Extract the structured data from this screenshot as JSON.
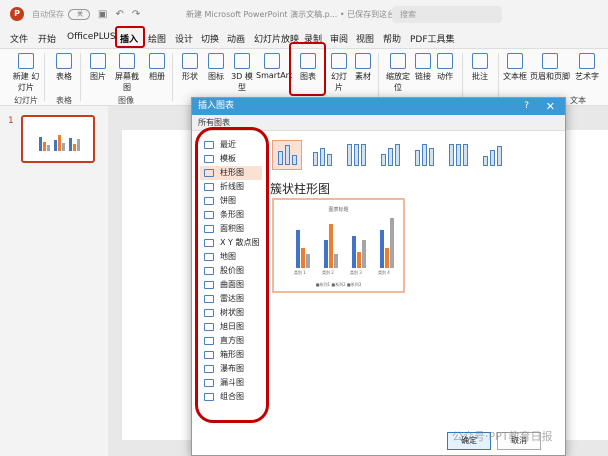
{
  "titlebar": {
    "autosave_label": "自动保存",
    "toggle_state": "关",
    "doc_title": "新建 Microsoft PowerPoint 演示文稿.p... • 已保存到这台电脑",
    "search_placeholder": "搜索"
  },
  "menu": {
    "tabs": [
      "文件",
      "开始",
      "OfficePLUS",
      "插入",
      "绘图",
      "设计",
      "切换",
      "动画",
      "幻灯片放映",
      "录制",
      "审阅",
      "视图",
      "帮助",
      "PDF工具集"
    ],
    "active_tab": "插入"
  },
  "ribbon": {
    "items": [
      "新建\n幻灯片",
      "表格",
      "图片",
      "屏幕截图",
      "相册",
      "形状",
      "图标",
      "3D 模型",
      "SmartArt",
      "图表",
      "幻灯片",
      "素材",
      "缩放定位",
      "链接",
      "动作",
      "批注",
      "文本框",
      "页眉和页脚",
      "艺术字"
    ],
    "groups": [
      "幻灯片",
      "表格",
      "图像",
      "文本"
    ]
  },
  "slide_panel": {
    "slide_number": "1"
  },
  "dialog": {
    "title": "插入图表",
    "help": "?",
    "close": "✕",
    "tab_label": "所有图表",
    "categories": [
      "最近",
      "模板",
      "柱形图",
      "折线图",
      "饼图",
      "条形图",
      "面积图",
      "X Y 散点图",
      "地图",
      "股价图",
      "曲面图",
      "雷达图",
      "树状图",
      "旭日图",
      "直方图",
      "箱形图",
      "瀑布图",
      "漏斗图",
      "组合图"
    ],
    "active_category": "柱形图",
    "subtype_title": "簇状柱形图",
    "preview": {
      "title": "图表标题",
      "categories": [
        "类别 1",
        "类别 2",
        "类别 3",
        "类别 4"
      ],
      "legend": "■系列1  ■系列2  ■系列3"
    },
    "ok_label": "确定",
    "cancel_label": "取消"
  },
  "watermark": "公众号·PPT教育日报"
}
